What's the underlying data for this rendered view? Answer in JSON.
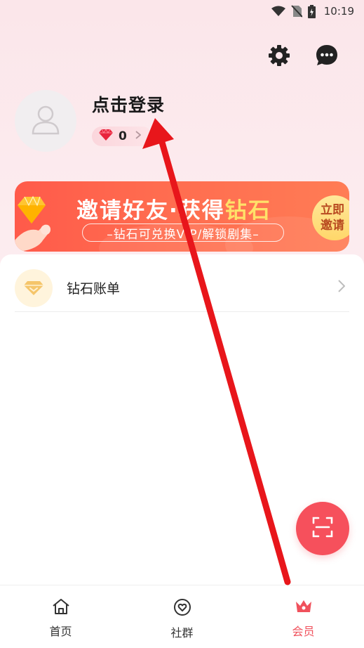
{
  "status_bar": {
    "time": "10:19",
    "icons": [
      "wifi-icon",
      "no-sim-icon",
      "battery-charging-icon"
    ]
  },
  "header": {
    "settings_icon": "gear-icon",
    "message_icon": "chat-bubble-icon"
  },
  "profile": {
    "login_prompt": "点击登录",
    "avatar_icon": "user-placeholder-icon",
    "diamond_count": "0",
    "diamond_icon": "red-diamond-icon"
  },
  "banner": {
    "headline_main": "邀请好友·获得",
    "headline_accent": "钻石",
    "subline": "–钻石可兑换VIP/解锁剧集–",
    "cta_line1": "立即",
    "cta_line2": "邀请"
  },
  "menu": {
    "items": [
      {
        "label": "钻石账单",
        "icon": "diamond-bill-icon"
      }
    ]
  },
  "fab": {
    "icon": "scan-icon"
  },
  "bottom_nav": {
    "items": [
      {
        "label": "首页",
        "icon": "home-icon",
        "active": false
      },
      {
        "label": "社群",
        "icon": "community-heart-icon",
        "active": false
      },
      {
        "label": "会员",
        "icon": "crown-icon",
        "active": true
      }
    ]
  },
  "colors": {
    "accent": "#f0515c",
    "banner_gradient_start": "#ff5a4a",
    "banner_gradient_end": "#ff7c55",
    "annotation_arrow": "#e8161b"
  }
}
